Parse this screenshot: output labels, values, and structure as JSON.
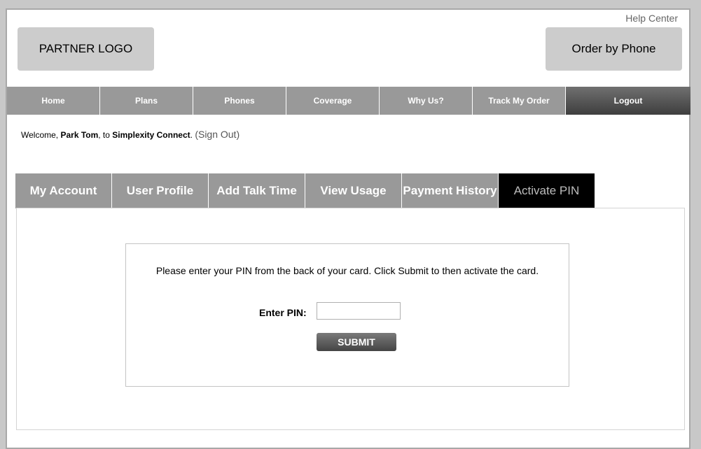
{
  "header": {
    "help_center": "Help Center",
    "partner_logo": "PARTNER LOGO",
    "order_by_phone": "Order by Phone"
  },
  "nav": {
    "items": [
      {
        "label": "Home"
      },
      {
        "label": "Plans"
      },
      {
        "label": "Phones"
      },
      {
        "label": "Coverage"
      },
      {
        "label": "Why Us?"
      },
      {
        "label": "Track My Order"
      },
      {
        "label": "Logout"
      }
    ]
  },
  "welcome": {
    "prefix": "Welcome, ",
    "user_name": "Park Tom",
    "middle": ", to ",
    "site_name": "Simplexity Connect",
    "suffix": ". ",
    "sign_out": "(Sign Out)"
  },
  "tabs": [
    {
      "label": "My Account"
    },
    {
      "label": "User Profile"
    },
    {
      "label": "Add Talk Time"
    },
    {
      "label": "View Usage"
    },
    {
      "label": "Payment History"
    },
    {
      "label": "Activate PIN"
    }
  ],
  "activate_pin": {
    "instruction": "Please enter your PIN from the back of your card. Click Submit to then activate the card.",
    "pin_label": "Enter PIN:",
    "pin_value": "",
    "submit_label": "SUBMIT"
  }
}
